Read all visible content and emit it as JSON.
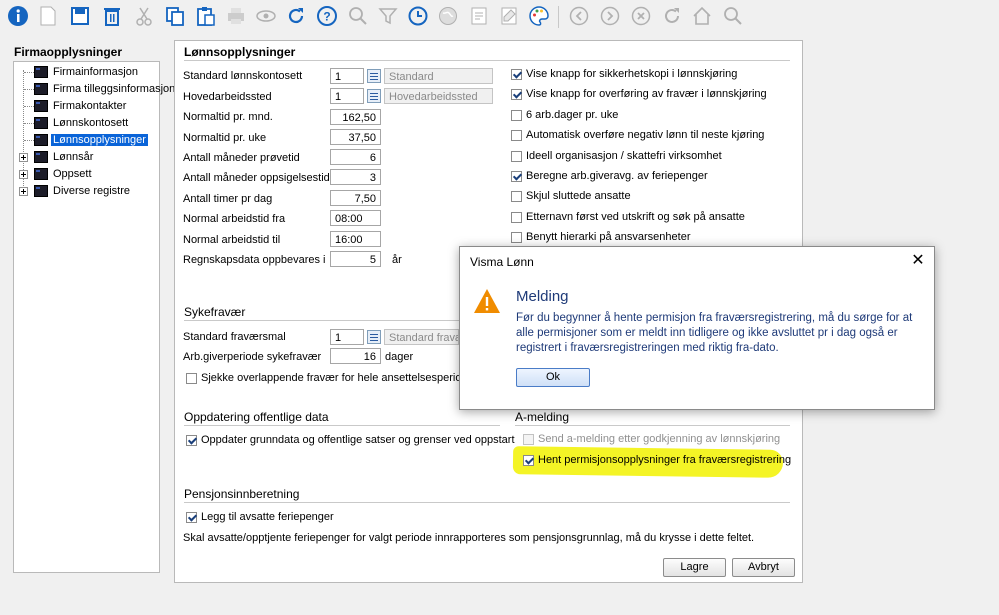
{
  "toolbar": {
    "icons": [
      "info-icon",
      "new-document-icon",
      "save-icon",
      "delete-icon",
      "cut-icon",
      "copy-icon",
      "paste-icon",
      "print-icon",
      "preview-icon",
      "refresh-icon",
      "help-icon",
      "search-icon",
      "filter-icon",
      "history-icon",
      "globe-icon",
      "notes-icon",
      "palette-icon",
      "back-icon",
      "forward-icon",
      "cancel-icon",
      "redo-icon",
      "home-icon",
      "zoom-icon"
    ]
  },
  "sidebar": {
    "title": "Firmaopplysninger",
    "items": [
      {
        "label": "Firmainformasjon"
      },
      {
        "label": "Firma tilleggsinformasjon"
      },
      {
        "label": "Firmakontakter"
      },
      {
        "label": "Lønnskontosett"
      },
      {
        "label": "Lønnsopplysninger"
      },
      {
        "label": "Lønnsår"
      },
      {
        "label": "Oppsett"
      },
      {
        "label": "Diverse registre"
      }
    ]
  },
  "main": {
    "title": "Lønnsopplysninger",
    "fields": [
      {
        "label": "Standard lønnskontosett",
        "value": "1",
        "desc": "Standard"
      },
      {
        "label": "Hovedarbeidssted",
        "value": "1",
        "desc": "Hovedarbeidssted"
      },
      {
        "label": "Normaltid pr. mnd.",
        "value": "162,50"
      },
      {
        "label": "Normaltid pr. uke",
        "value": "37,50"
      },
      {
        "label": "Antall måneder prøvetid",
        "value": "6"
      },
      {
        "label": "Antall måneder oppsigelsestid",
        "value": "3"
      },
      {
        "label": "Antall timer pr dag",
        "value": "7,50"
      },
      {
        "label": "Normal arbeidstid fra",
        "value": "08:00"
      },
      {
        "label": "Normal arbeidstid til",
        "value": "16:00"
      },
      {
        "label": "Regnskapsdata oppbevares i",
        "value": "5",
        "suffix": "år"
      }
    ],
    "checkboxes": [
      {
        "label": "Vise knapp for sikkerhetskopi i lønnskjøring",
        "checked": true
      },
      {
        "label": "Vise knapp for overføring av fravær i lønnskjøring",
        "checked": true
      },
      {
        "label": "6 arb.dager pr. uke",
        "checked": false
      },
      {
        "label": "Automatisk overføre negativ lønn til neste kjøring",
        "checked": false
      },
      {
        "label": "Ideell organisasjon / skattefri virksomhet",
        "checked": false
      },
      {
        "label": "Beregne arb.giveravg. av feriepenger",
        "checked": true
      },
      {
        "label": "Skjul sluttede ansatte",
        "checked": false
      },
      {
        "label": "Etternavn først ved utskrift og søk på ansatte",
        "checked": false
      },
      {
        "label": "Benytt hierarki på ansvarsenheter",
        "checked": false
      }
    ],
    "sykefravaer": {
      "title": "Sykefravær",
      "standard_label": "Standard fraværsmal",
      "standard_value": "1",
      "standard_desc": "Standard fravæ",
      "giverperiode_label": "Arb.giverperiode sykefravær",
      "giverperiode_value": "16",
      "giverperiode_suffix": "dager",
      "overlapp_label": "Sjekke overlappende fravær for hele ansettelsesperioden"
    },
    "oppdatering": {
      "title": "Oppdatering offentlige data",
      "checkbox_label": "Oppdater grunndata og offentlige satser og grenser ved oppstart"
    },
    "amelding": {
      "title": "A-melding",
      "send_label": "Send a-melding etter godkjenning av lønnskjøring",
      "hent_label": "Hent permisjonsopplysninger fra fraværsregistrering"
    },
    "pensjon": {
      "title": "Pensjonsinnberetning",
      "checkbox_label": "Legg til avsatte feriepenger",
      "note": "Skal avsatte/opptjente feriepenger for valgt periode innrapporteres som pensjonsgrunnlag, må du krysse i dette feltet."
    },
    "buttons": {
      "save": "Lagre",
      "cancel": "Avbryt"
    }
  },
  "dialog": {
    "title": "Visma Lønn",
    "close": "✕",
    "heading": "Melding",
    "message": "Før du begynner å hente permisjon fra fraværsregistrering, må du sørge for at alle permisjoner som er meldt inn tidligere og ikke avsluttet pr i dag også er registrert i fraværsregistreringen med riktig fra-dato.",
    "ok": "Ok"
  },
  "colors": {
    "accent": "#0a64d8",
    "dialog_text": "#1e3a78",
    "highlight": "#f2f200",
    "warning": "#f08c00"
  }
}
